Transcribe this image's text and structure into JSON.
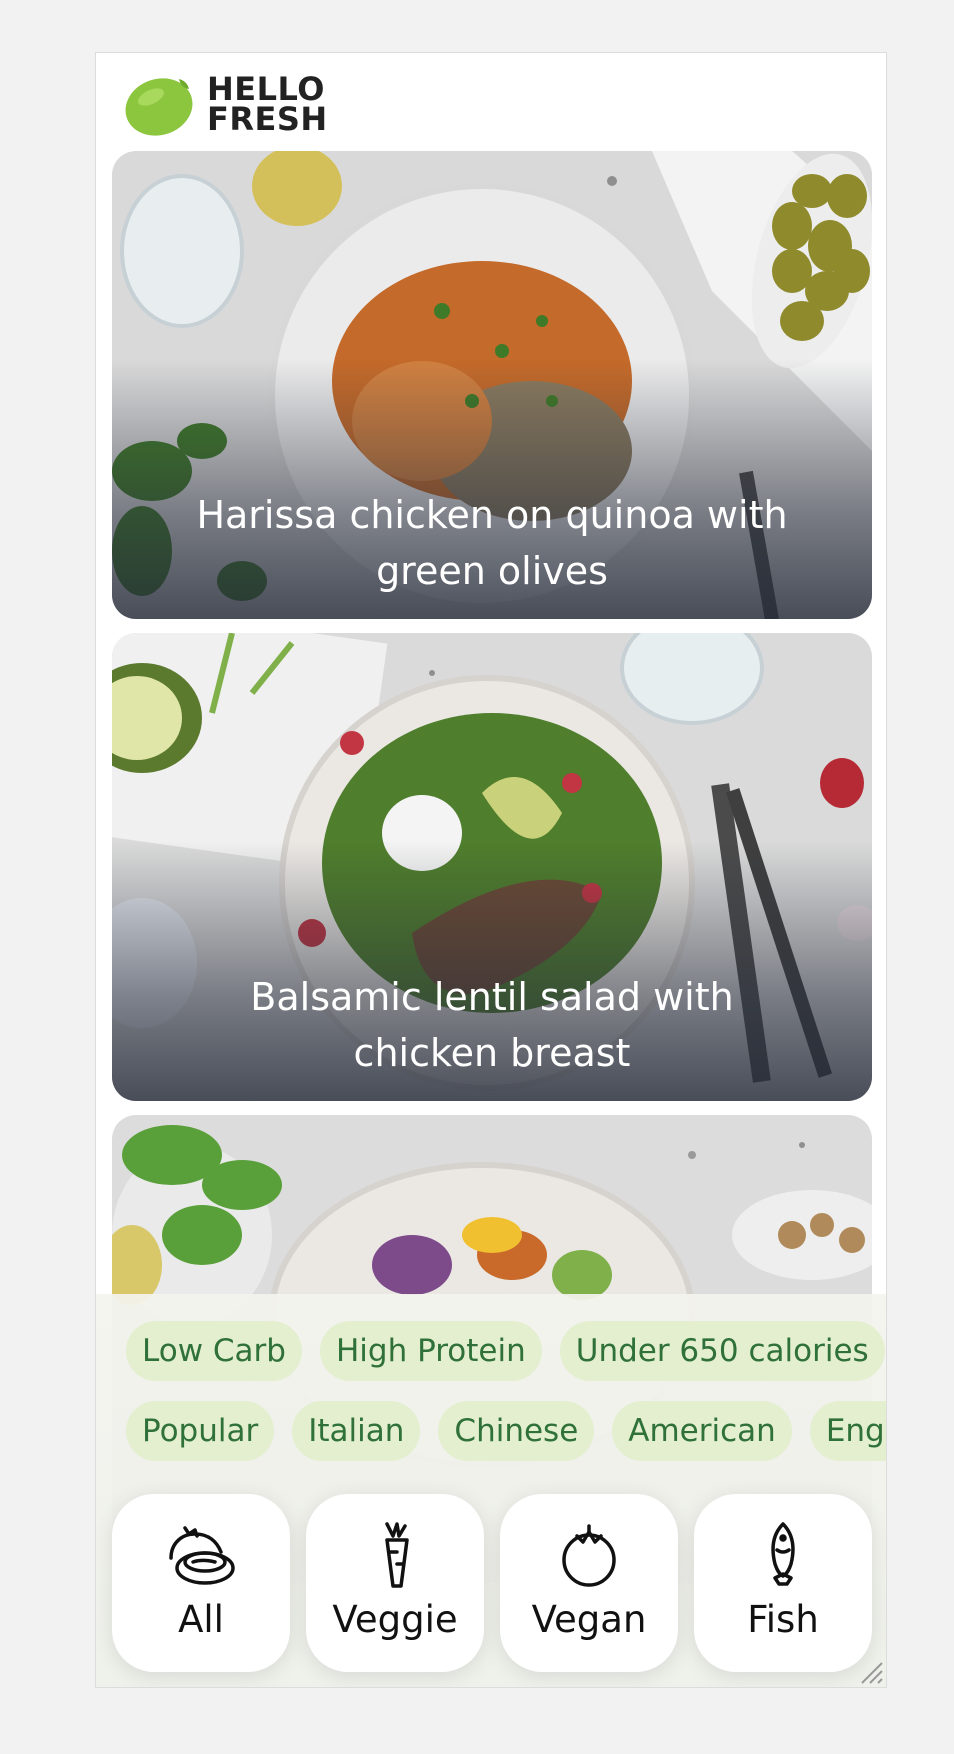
{
  "brand": {
    "line1": "HELLO",
    "line2": "FRESH",
    "colors": {
      "lime": "#8cc63f",
      "dark_text": "#222222"
    }
  },
  "recipes": [
    {
      "title": "Harissa chicken on quinoa with green olives"
    },
    {
      "title": "Balsamic lentil salad with chicken breast"
    },
    {
      "title": ""
    }
  ],
  "filters": {
    "row1": [
      "Low Carb",
      "High Protein",
      "Under 650 calories"
    ],
    "row2": [
      "Popular",
      "Italian",
      "Chinese",
      "American",
      "English"
    ],
    "chip_colors": {
      "background": "#e3efcf",
      "text": "#2f7139"
    }
  },
  "diet_types": [
    {
      "label": "All",
      "icon": "meat-icon"
    },
    {
      "label": "Veggie",
      "icon": "carrot-icon"
    },
    {
      "label": "Vegan",
      "icon": "tomato-icon"
    },
    {
      "label": "Fish",
      "icon": "fish-icon"
    }
  ]
}
